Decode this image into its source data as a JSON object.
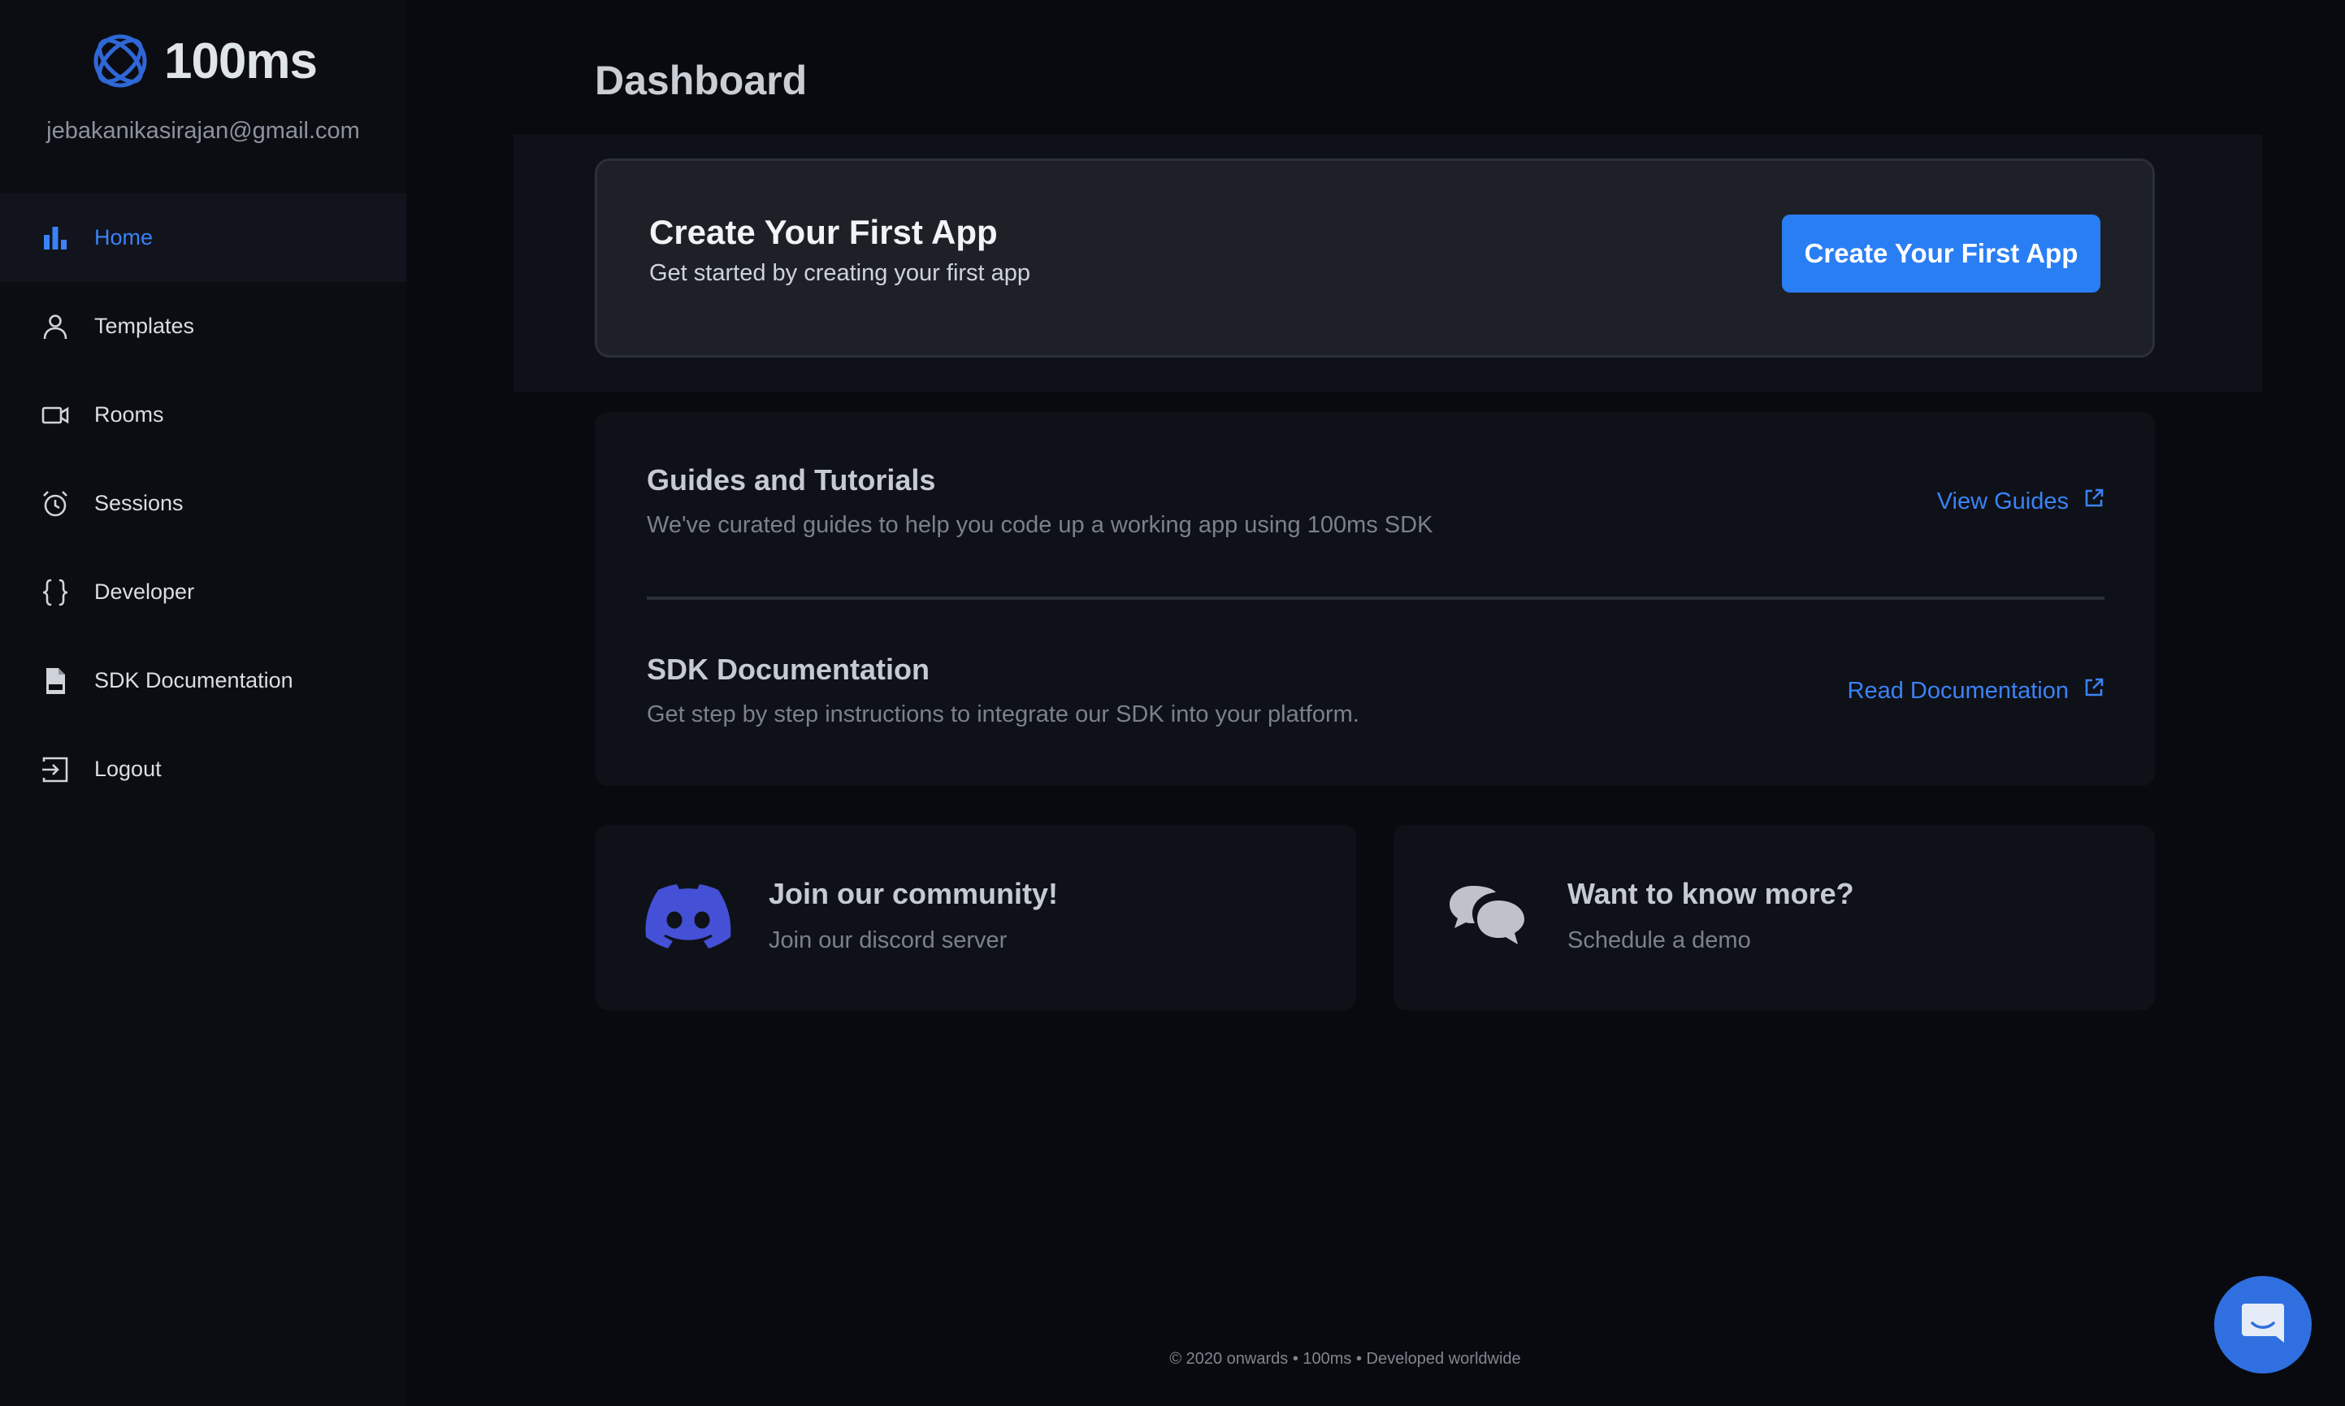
{
  "brand": {
    "name": "100ms",
    "accent": "#3b82f6"
  },
  "user": {
    "email": "jebakanikasirajan@gmail.com"
  },
  "sidebar": {
    "items": [
      {
        "label": "Home",
        "icon": "bar-chart-icon",
        "active": true
      },
      {
        "label": "Templates",
        "icon": "user-icon",
        "active": false
      },
      {
        "label": "Rooms",
        "icon": "video-camera-icon",
        "active": false
      },
      {
        "label": "Sessions",
        "icon": "alarm-clock-icon",
        "active": false
      },
      {
        "label": "Developer",
        "icon": "curly-braces-icon",
        "active": false
      },
      {
        "label": "SDK Documentation",
        "icon": "document-icon",
        "active": false
      },
      {
        "label": "Logout",
        "icon": "logout-icon",
        "active": false
      }
    ]
  },
  "main": {
    "title": "Dashboard",
    "hero": {
      "title": "Create Your First App",
      "subtitle": "Get started by creating your first app",
      "button_label": "Create Your First App",
      "button_color": "#2a7ef4"
    },
    "resources": [
      {
        "title": "Guides and Tutorials",
        "description": "We've curated guides to help you code up a working app using 100ms SDK",
        "link_label": "View Guides"
      },
      {
        "title": "SDK Documentation",
        "description": "Get step by step instructions to integrate our SDK into your platform.",
        "link_label": "Read Documentation"
      }
    ],
    "cards": [
      {
        "title": "Join our community!",
        "subtitle": "Join our discord server",
        "icon": "discord-icon",
        "icon_color": "#4450d6"
      },
      {
        "title": "Want to know more?",
        "subtitle": "Schedule a demo",
        "icon": "chat-bubbles-icon",
        "icon_color": "#bfc3c9"
      }
    ]
  },
  "footer": {
    "text": "© 2020 onwards • 100ms • Developed worldwide"
  },
  "chat_launcher": {
    "icon": "chat-launcher-icon",
    "color": "#2f6fe0"
  }
}
